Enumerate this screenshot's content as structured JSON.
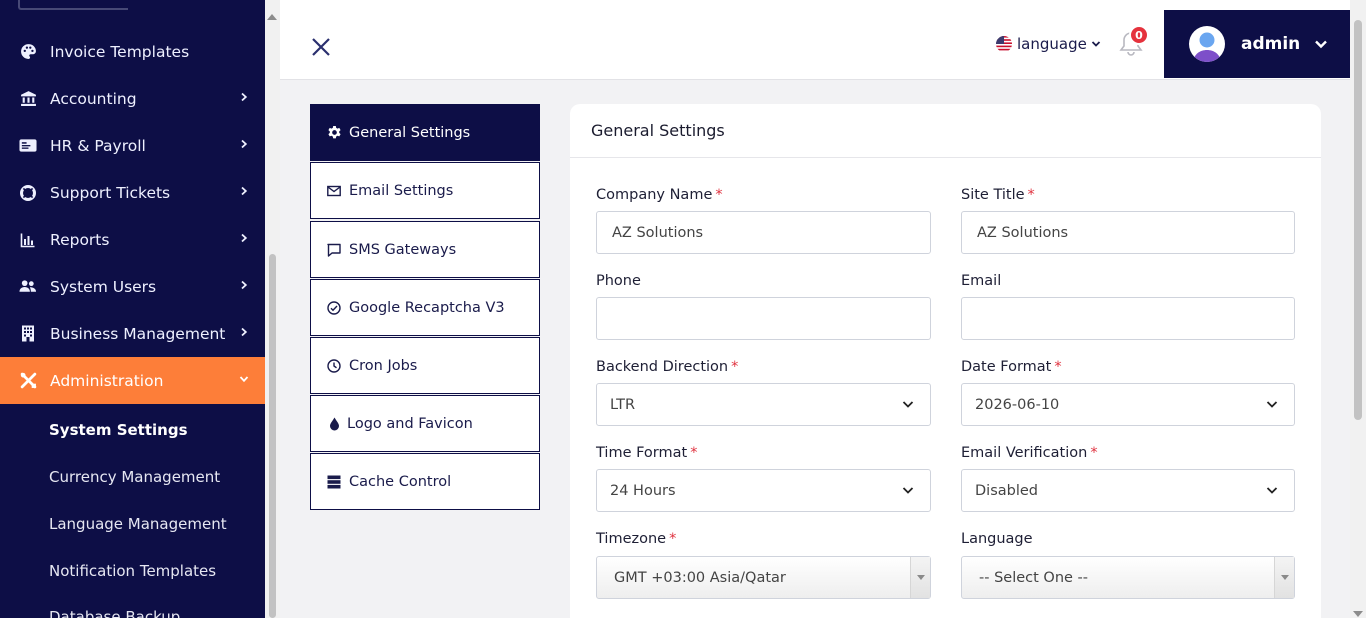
{
  "sidebar": {
    "items": [
      {
        "label": "Invoice Templates",
        "icon": "palette-icon",
        "has_chevron": false
      },
      {
        "label": "Accounting",
        "icon": "bank-icon",
        "has_chevron": true
      },
      {
        "label": "HR & Payroll",
        "icon": "id-card-icon",
        "has_chevron": true
      },
      {
        "label": "Support Tickets",
        "icon": "lifebuoy-icon",
        "has_chevron": true
      },
      {
        "label": "Reports",
        "icon": "bar-chart-icon",
        "has_chevron": true
      },
      {
        "label": "System Users",
        "icon": "users-icon",
        "has_chevron": true
      },
      {
        "label": "Business Management",
        "icon": "building-icon",
        "has_chevron": true
      },
      {
        "label": "Administration",
        "icon": "tools-icon",
        "has_chevron": true
      }
    ],
    "sub_items": [
      {
        "label": "System Settings"
      },
      {
        "label": "Currency Management"
      },
      {
        "label": "Language Management"
      },
      {
        "label": "Notification Templates"
      },
      {
        "label": "Database Backup"
      }
    ],
    "active_color": "#fd7e39",
    "bg_color": "#0d0e46"
  },
  "header": {
    "language_label": "language",
    "notification_count": "0",
    "user_name": "admin"
  },
  "settings_nav": [
    {
      "label": "General Settings",
      "icon": "gear-icon"
    },
    {
      "label": "Email Settings",
      "icon": "envelope-icon"
    },
    {
      "label": "SMS Gateways",
      "icon": "chat-bubble-icon"
    },
    {
      "label": "Google Recaptcha V3",
      "icon": "check-circle-icon"
    },
    {
      "label": "Cron Jobs",
      "icon": "clock-icon"
    },
    {
      "label": "Logo and Favicon",
      "icon": "droplet-icon"
    },
    {
      "label": "Cache Control",
      "icon": "server-icon"
    }
  ],
  "card": {
    "title": "General Settings",
    "fields": {
      "company_name": {
        "label": "Company Name",
        "required_mark": "*",
        "value": "AZ Solutions"
      },
      "site_title": {
        "label": "Site Title",
        "required_mark": "*",
        "value": "AZ Solutions"
      },
      "phone": {
        "label": "Phone",
        "value": ""
      },
      "email": {
        "label": "Email",
        "value": ""
      },
      "backend_direction": {
        "label": "Backend Direction",
        "required_mark": "*",
        "value": "LTR"
      },
      "date_format": {
        "label": "Date Format",
        "required_mark": "*",
        "value": "2026-06-10"
      },
      "time_format": {
        "label": "Time Format",
        "required_mark": "*",
        "value": "24 Hours"
      },
      "email_verification": {
        "label": "Email Verification",
        "required_mark": "*",
        "value": "Disabled"
      },
      "timezone": {
        "label": "Timezone",
        "required_mark": "*",
        "value": "GMT +03:00 Asia/Qatar"
      },
      "language": {
        "label": "Language",
        "value": "-- Select One --"
      }
    }
  }
}
